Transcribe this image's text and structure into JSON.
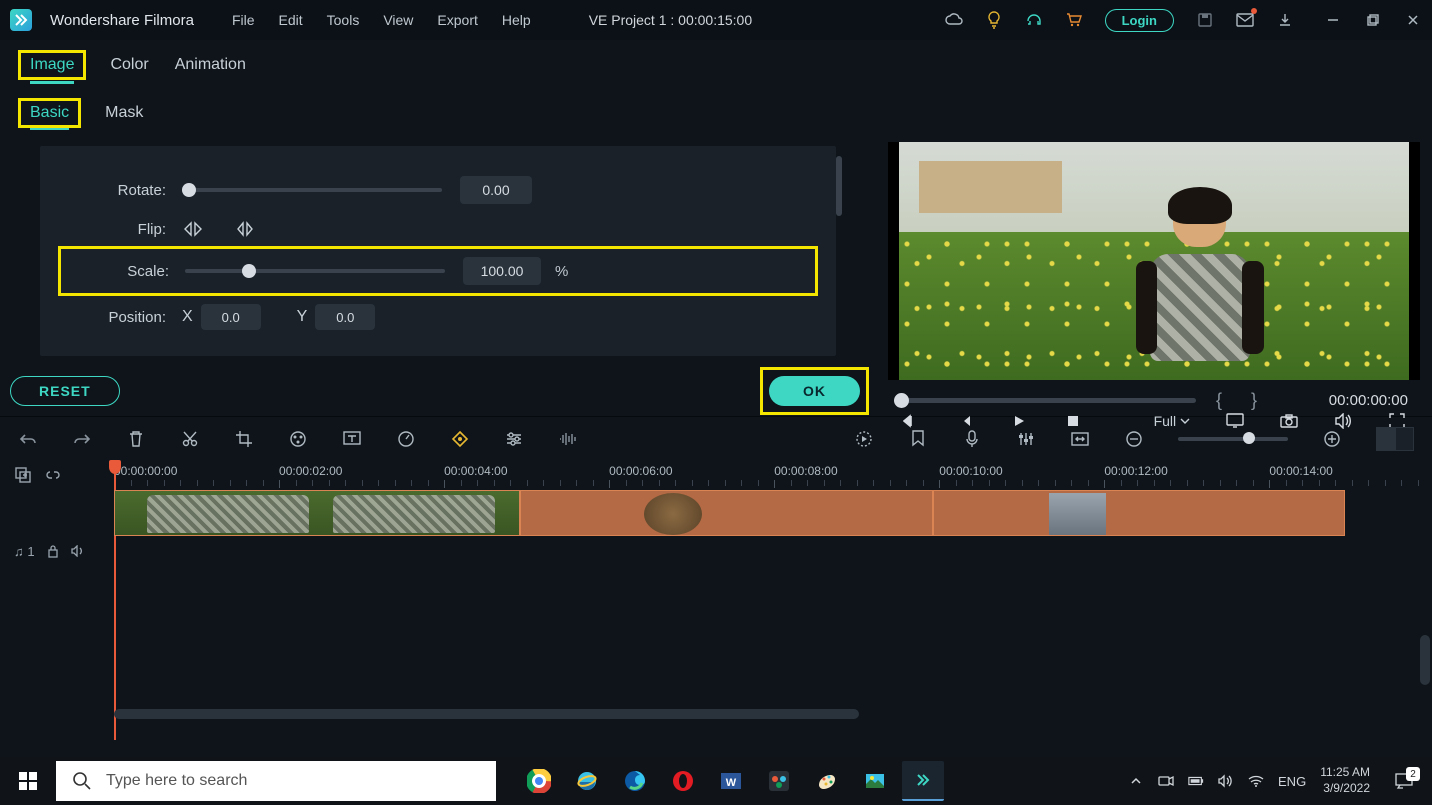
{
  "app": {
    "name": "Wondershare Filmora"
  },
  "menu": {
    "file": "File",
    "edit": "Edit",
    "tools": "Tools",
    "view": "View",
    "export": "Export",
    "help": "Help"
  },
  "project": {
    "title": "VE Project 1 : 00:00:15:00"
  },
  "login": {
    "label": "Login"
  },
  "tabs": {
    "image": "Image",
    "color": "Color",
    "animation": "Animation"
  },
  "subtabs": {
    "basic": "Basic",
    "mask": "Mask"
  },
  "props": {
    "rotate_label": "Rotate:",
    "rotate_value": "0.00",
    "flip_label": "Flip:",
    "scale_label": "Scale:",
    "scale_value": "100.00",
    "scale_unit": "%",
    "position_label": "Position:",
    "pos_x_label": "X",
    "pos_x_value": "0.0",
    "pos_y_label": "Y",
    "pos_y_value": "0.0"
  },
  "buttons": {
    "reset": "RESET",
    "ok": "OK"
  },
  "preview": {
    "timecode": "00:00:00:00",
    "full": "Full"
  },
  "timeline": {
    "marks": [
      "00:00:00:00",
      "00:00:02:00",
      "00:00:04:00",
      "00:00:06:00",
      "00:00:08:00",
      "00:00:10:00",
      "00:00:12:00",
      "00:00:14:00"
    ],
    "audio_track_label": "♫ 1"
  },
  "taskbar": {
    "search_placeholder": "Type here to search",
    "lang": "ENG",
    "time": "11:25 AM",
    "date": "3/9/2022",
    "notif_count": "2"
  }
}
